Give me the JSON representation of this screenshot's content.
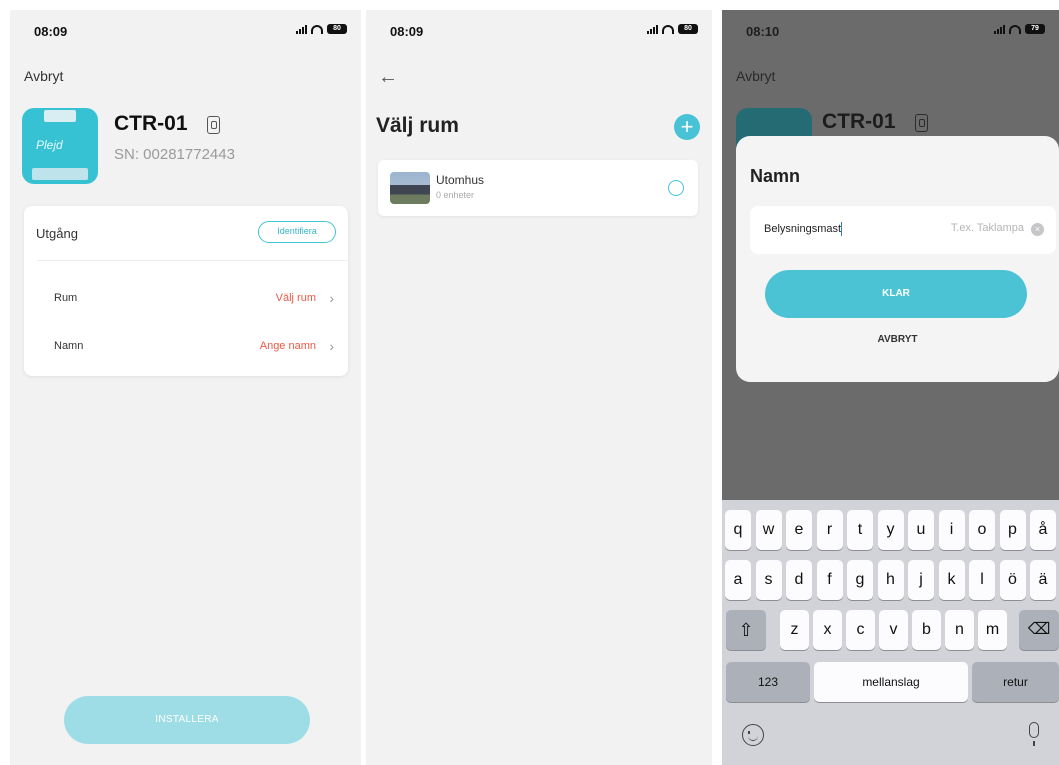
{
  "screen1": {
    "status": {
      "time": "08:09",
      "battery": "80"
    },
    "cancel_link": "Avbryt",
    "device": {
      "icon_text": "Plejd",
      "name": "CTR-01",
      "serial": "SN: 00281772443"
    },
    "card": {
      "heading": "Utgång",
      "identify_label": "Identifiera",
      "rows": [
        {
          "label": "Rum",
          "value": "Välj rum"
        },
        {
          "label": "Namn",
          "value": "Ange namn"
        }
      ]
    },
    "install_label": "INSTALLERA"
  },
  "screen2": {
    "status": {
      "time": "08:09",
      "battery": "80"
    },
    "title": "Välj rum",
    "add_label": "+",
    "rooms": [
      {
        "name": "Utomhus",
        "count": "0 enheter"
      }
    ]
  },
  "screen3": {
    "status": {
      "time": "08:10",
      "battery": "79"
    },
    "cancel_link": "Avbryt",
    "device_name": "CTR-01",
    "modal": {
      "title": "Namn",
      "input_value": "Belysningsmast",
      "input_placeholder": "T.ex. Taklampa",
      "done_label": "KLAR",
      "cancel_label": "AVBRYT"
    },
    "keyboard": {
      "row1": [
        "q",
        "w",
        "e",
        "r",
        "t",
        "y",
        "u",
        "i",
        "o",
        "p",
        "å"
      ],
      "row2": [
        "a",
        "s",
        "d",
        "f",
        "g",
        "h",
        "j",
        "k",
        "l",
        "ö",
        "ä"
      ],
      "row3": [
        "z",
        "x",
        "c",
        "v",
        "b",
        "n",
        "m"
      ],
      "shift_icon": "shift-icon",
      "backspace_icon": "backspace-icon",
      "numbers_label": "123",
      "space_label": "mellanslag",
      "return_label": "retur",
      "emoji_icon": "emoji-icon",
      "mic_icon": "microphone-icon"
    }
  },
  "colors": {
    "accent": "#48c2d6",
    "link_red": "#ea5a45",
    "install_disabled": "#9fdde6",
    "background": "#f2f2f3",
    "overlay": "#6b6b6c",
    "keyboard_bg": "#d1d3d9"
  }
}
